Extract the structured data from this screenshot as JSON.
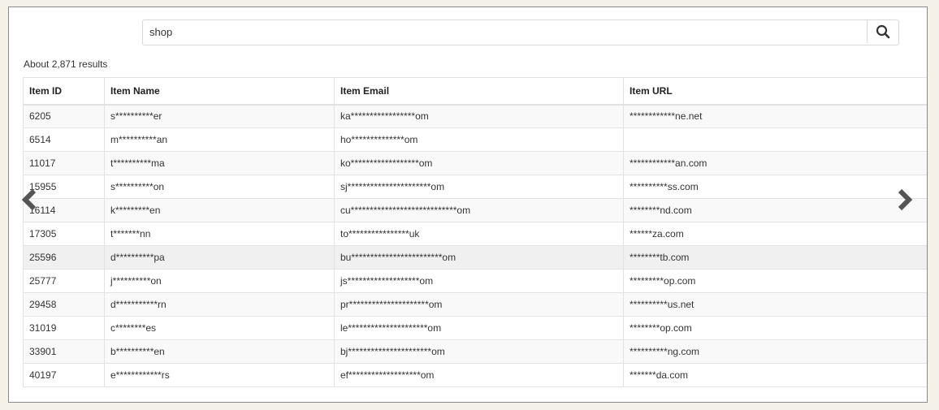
{
  "search": {
    "value": "shop",
    "placeholder": ""
  },
  "result_count": "About 2,871 results",
  "table": {
    "headers": [
      "Item ID",
      "Item Name",
      "Item Email",
      "Item URL"
    ],
    "rows": [
      [
        "6205",
        "s**********er",
        "ka*****************om",
        "************ne.net"
      ],
      [
        "6514",
        "m**********an",
        "ho**************om",
        ""
      ],
      [
        "11017",
        "t**********ma",
        "ko******************om",
        "************an.com"
      ],
      [
        "15955",
        "s**********on",
        "sj**********************om",
        "**********ss.com"
      ],
      [
        "16114",
        "k*********en",
        "cu****************************om",
        "********nd.com"
      ],
      [
        "17305",
        "t*******nn",
        "to****************uk",
        "******za.com"
      ],
      [
        "25596",
        "d**********pa",
        "bu************************om",
        "********tb.com"
      ],
      [
        "25777",
        "j**********on",
        "js*******************om",
        "*********op.com"
      ],
      [
        "29458",
        "d***********rn",
        "pr*********************om",
        "**********us.net"
      ],
      [
        "31019",
        "c********es",
        "le*********************om",
        "********op.com"
      ],
      [
        "33901",
        "b**********en",
        "bj**********************om",
        "**********ng.com"
      ],
      [
        "40197",
        "e************rs",
        "ef*******************om",
        "*******da.com"
      ]
    ]
  },
  "nav": {
    "prev_icon": "chevron-left-icon",
    "next_icon": "chevron-right-icon"
  },
  "colors": {
    "background": "#f4f1e8",
    "panel": "#ffffff",
    "border": "#e2e2e2",
    "arrow": "#555555"
  }
}
